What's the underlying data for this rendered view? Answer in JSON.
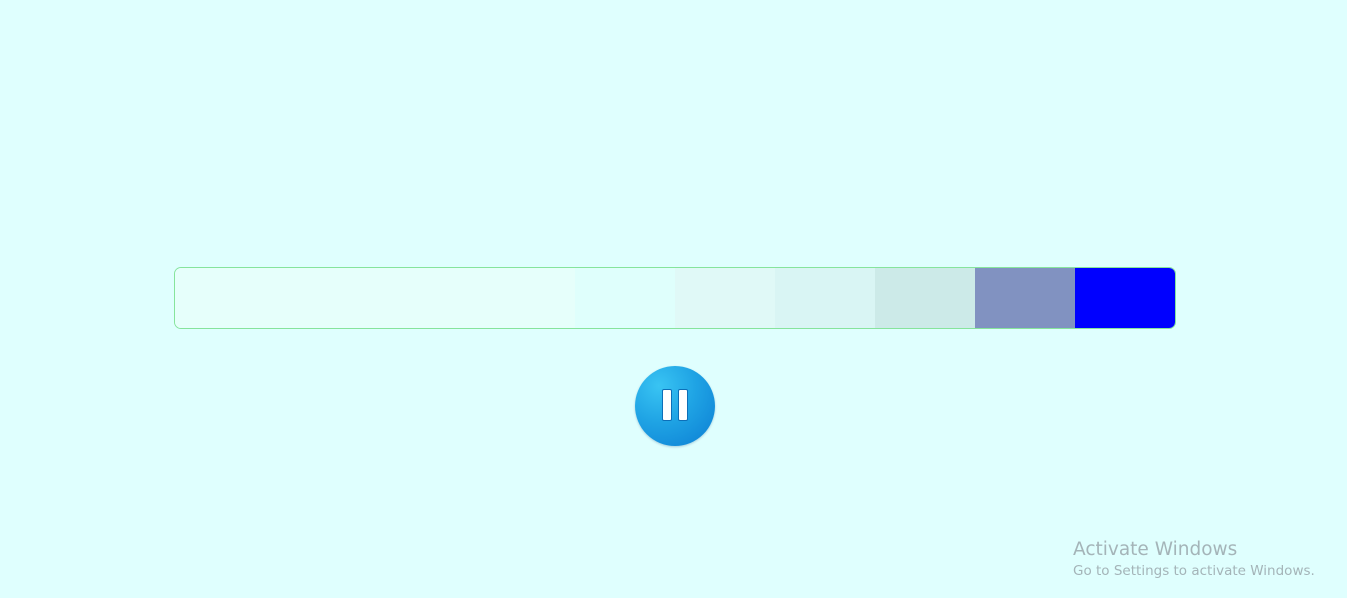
{
  "colors": {
    "background": "#dffffe",
    "bar_border": "#86e49c",
    "button_accent": "#1fa3e4"
  },
  "bar": {
    "segments": [
      {
        "name": "segment-1",
        "color": "#e6fffb"
      },
      {
        "name": "segment-2",
        "color": "#e6fffb"
      },
      {
        "name": "segment-3",
        "color": "#e6fffb"
      },
      {
        "name": "segment-4",
        "color": "#e6fffb"
      },
      {
        "name": "segment-5",
        "color": "#dffffc"
      },
      {
        "name": "segment-6",
        "color": "#e0f9f7"
      },
      {
        "name": "segment-7",
        "color": "#d9f5f4"
      },
      {
        "name": "segment-8",
        "color": "#cceae8"
      },
      {
        "name": "segment-9",
        "color": "#8192c1"
      },
      {
        "name": "segment-10",
        "color": "#0000ff"
      }
    ]
  },
  "controls": {
    "pause_icon": "pause-icon"
  },
  "watermark": {
    "title": "Activate Windows",
    "subtitle": "Go to Settings to activate Windows."
  }
}
